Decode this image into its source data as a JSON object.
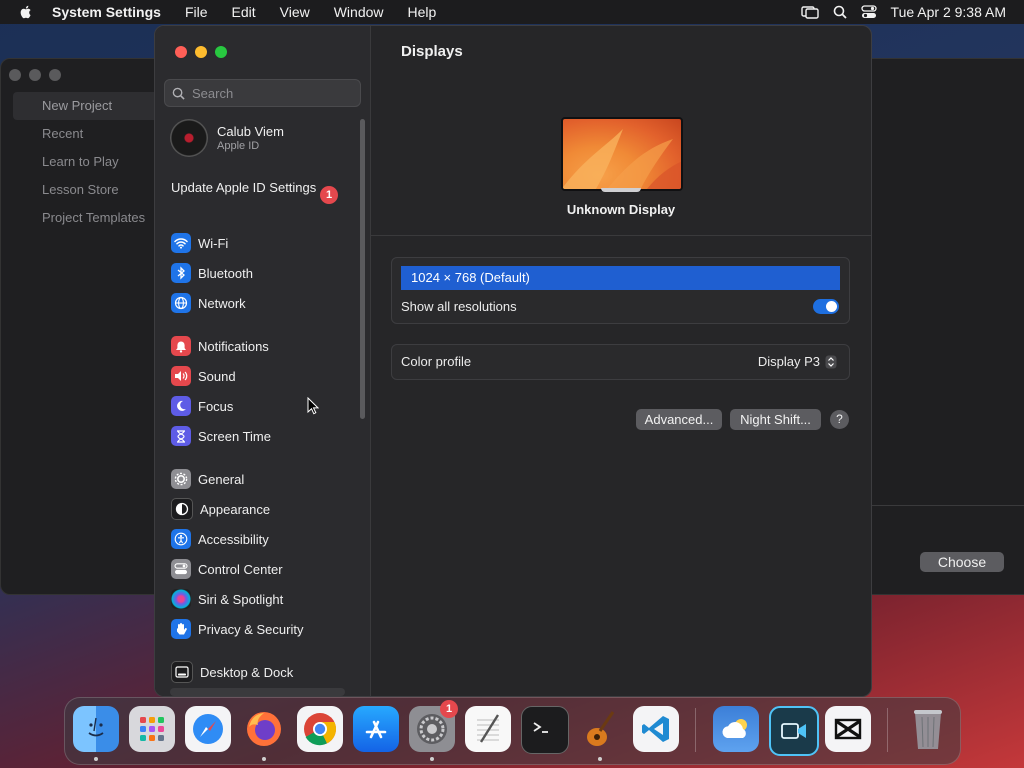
{
  "menubar": {
    "app_name": "System Settings",
    "items": [
      "File",
      "Edit",
      "View",
      "Window",
      "Help"
    ],
    "clock": "Tue Apr 2  9:38 AM"
  },
  "background_window": {
    "sidebar": [
      "New Project",
      "Recent",
      "Learn to Play",
      "Lesson Store",
      "Project Templates"
    ],
    "choose_label": "Choose"
  },
  "sidebar": {
    "search_placeholder": "Search",
    "user_name": "Calub Viem",
    "user_sub": "Apple ID",
    "update_label": "Update Apple ID Settings",
    "update_badge": "1",
    "items": [
      {
        "label": "Wi-Fi",
        "icon": "wifi-icon",
        "color": "#1f74e8"
      },
      {
        "label": "Bluetooth",
        "icon": "bluetooth-icon",
        "color": "#1f74e8"
      },
      {
        "label": "Network",
        "icon": "globe-icon",
        "color": "#1f74e8"
      },
      {
        "label": "Notifications",
        "icon": "bell-icon",
        "color": "#e5484d"
      },
      {
        "label": "Sound",
        "icon": "speaker-icon",
        "color": "#e5484d"
      },
      {
        "label": "Focus",
        "icon": "moon-icon",
        "color": "#5e5ce6"
      },
      {
        "label": "Screen Time",
        "icon": "hourglass-icon",
        "color": "#5e5ce6"
      },
      {
        "label": "General",
        "icon": "gear-icon",
        "color": "#8e8e93"
      },
      {
        "label": "Appearance",
        "icon": "appearance-icon",
        "color": "#1c1c1e"
      },
      {
        "label": "Accessibility",
        "icon": "accessibility-icon",
        "color": "#1f74e8"
      },
      {
        "label": "Control Center",
        "icon": "control-center-icon",
        "color": "#8e8e93"
      },
      {
        "label": "Siri & Spotlight",
        "icon": "siri-icon",
        "color": "#9b59b6"
      },
      {
        "label": "Privacy & Security",
        "icon": "hand-icon",
        "color": "#1f74e8"
      },
      {
        "label": "Desktop & Dock",
        "icon": "dock-icon",
        "color": "#1c1c1e"
      }
    ]
  },
  "displays": {
    "title": "Displays",
    "display_name": "Unknown Display",
    "resolution": "1024 × 768 (Default)",
    "show_all_label": "Show all resolutions",
    "show_all_on": true,
    "color_profile_label": "Color profile",
    "color_profile_value": "Display P3",
    "advanced_label": "Advanced...",
    "night_shift_label": "Night Shift...",
    "help_label": "?"
  },
  "dock": {
    "apps": [
      "finder-icon",
      "launchpad-icon",
      "safari-icon",
      "firefox-icon",
      "chrome-icon",
      "app-store-icon",
      "system-settings-icon",
      "textedit-icon",
      "terminal-icon",
      "garageband-icon",
      "vscode-icon",
      "weather-icon",
      "screen-recorder-icon",
      "capcut-icon",
      "trash-icon"
    ],
    "settings_badge": "1"
  }
}
